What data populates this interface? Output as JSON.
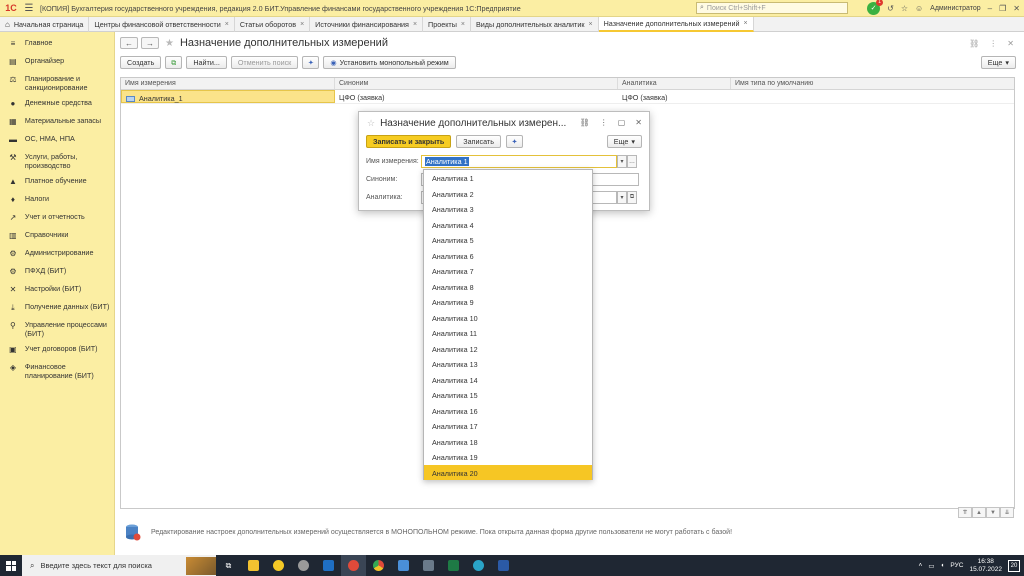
{
  "titlebar": {
    "logo": "1С",
    "title": "[КОПИЯ] Бухгалтерия государственного учреждения, редакция 2.0 БИТ.Управление финансами государственного учреждения 1С:Предприятие",
    "search_placeholder": "Поиск Ctrl+Shift+F",
    "notification_count": "1",
    "user": "Администратор"
  },
  "tabs": [
    {
      "label": "Начальная страница"
    },
    {
      "label": "Центры финансовой ответственности"
    },
    {
      "label": "Статьи оборотов"
    },
    {
      "label": "Источники финансирования"
    },
    {
      "label": "Проекты"
    },
    {
      "label": "Виды дополнительных аналитик"
    },
    {
      "label": "Назначение дополнительных измерений"
    }
  ],
  "sidebar": {
    "items": [
      {
        "label": "Главное",
        "icon": "menu-icon"
      },
      {
        "label": "Органайзер",
        "icon": "organizer-icon"
      },
      {
        "label": "Планирование и санкционирование",
        "icon": "planning-icon"
      },
      {
        "label": "Денежные средства",
        "icon": "money-icon"
      },
      {
        "label": "Материальные запасы",
        "icon": "inventory-icon"
      },
      {
        "label": "ОС, НМА, НПА",
        "icon": "assets-icon"
      },
      {
        "label": "Услуги, работы, производство",
        "icon": "services-icon"
      },
      {
        "label": "Платное обучение",
        "icon": "education-icon"
      },
      {
        "label": "Налоги",
        "icon": "taxes-icon"
      },
      {
        "label": "Учет и отчетность",
        "icon": "reports-icon"
      },
      {
        "label": "Справочники",
        "icon": "catalogs-icon"
      },
      {
        "label": "Администрирование",
        "icon": "gear-icon"
      },
      {
        "label": "ПФХД (БИТ)",
        "icon": "pfhd-icon"
      },
      {
        "label": "Настройки (БИТ)",
        "icon": "settings-icon"
      },
      {
        "label": "Получение данных (БИТ)",
        "icon": "download-icon"
      },
      {
        "label": "Управление процессами (БИТ)",
        "icon": "process-icon"
      },
      {
        "label": "Учет договоров (БИТ)",
        "icon": "contracts-icon"
      },
      {
        "label": "Финансовое планирование (БИТ)",
        "icon": "finance-icon"
      }
    ]
  },
  "page": {
    "title": "Назначение дополнительных измерений",
    "toolbar": {
      "create": "Создать",
      "find": "Найти...",
      "cancel_search": "Отменить поиск",
      "monopoly": "Установить монопольный режим",
      "more": "Еще"
    },
    "table": {
      "columns": [
        "Имя измерения",
        "Синоним",
        "Аналитика",
        "Имя типа по умолчанию"
      ],
      "rows": [
        {
          "name": "Аналитика_1",
          "synonym": "ЦФО (заявка)",
          "analytics": "ЦФО (заявка)",
          "type_name": ""
        }
      ]
    },
    "footer_note": "Редактирование настроек дополнительных измерений осуществляется в МОНОПОЛЬНОМ режиме. Пока открыта данная форма другие пользователи не могут работать с базой!"
  },
  "dialog": {
    "title": "Назначение дополнительных измерен...",
    "save_close": "Записать и закрыть",
    "save": "Записать",
    "more": "Еще",
    "fields": {
      "name_label": "Имя измерения:",
      "name_value": "Аналитика 1",
      "synonym_label": "Синоним:",
      "synonym_value": "",
      "analytics_label": "Аналитика:",
      "analytics_value": ""
    }
  },
  "dropdown": {
    "items": [
      "Аналитика 1",
      "Аналитика 2",
      "Аналитика 3",
      "Аналитика 4",
      "Аналитика 5",
      "Аналитика 6",
      "Аналитика 7",
      "Аналитика 8",
      "Аналитика 9",
      "Аналитика 10",
      "Аналитика 11",
      "Аналитика 12",
      "Аналитика 13",
      "Аналитика 14",
      "Аналитика 15",
      "Аналитика 16",
      "Аналитика 17",
      "Аналитика 18",
      "Аналитика 19",
      "Аналитика 20"
    ],
    "selected_index": 19
  },
  "taskbar": {
    "search_placeholder": "Введите здесь текст для поиска",
    "language": "РУС",
    "time": "16:38",
    "date": "15.07.2022",
    "notifications": "20"
  },
  "colors": {
    "accent": "#f6c832",
    "sidebar_bg": "#fbeea3",
    "selection": "#fbe38a"
  }
}
